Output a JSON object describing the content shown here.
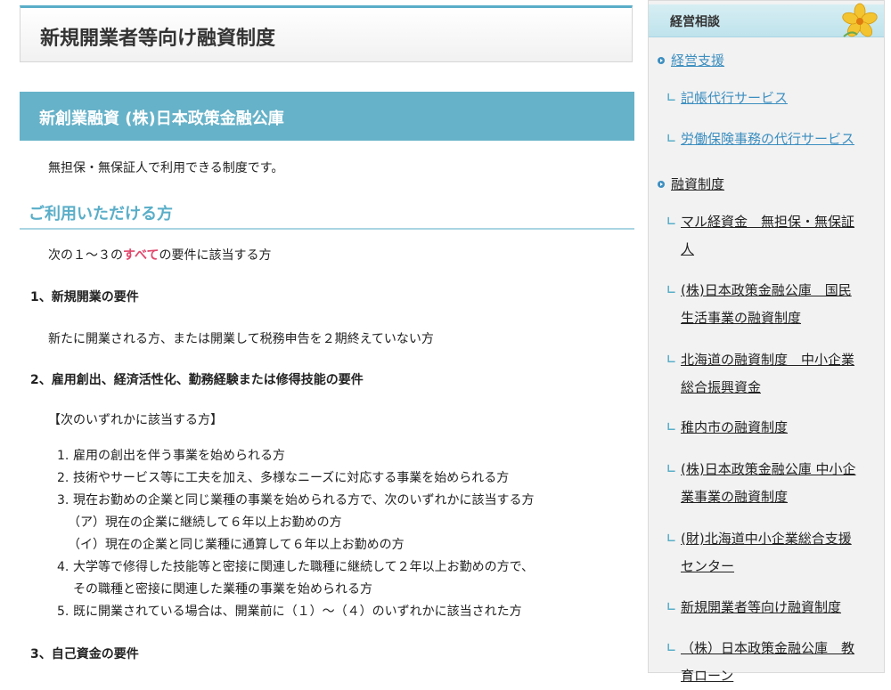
{
  "main": {
    "page_title": "新規開業者等向け融資制度",
    "section_title": "新創業融資 (株)日本政策金融公庫",
    "intro": "無担保・無保証人で利用できる制度です。",
    "eligible_heading": "ご利用いただける方",
    "req_intro_before": "次の１～３の",
    "req_intro_emph": "すべて",
    "req_intro_after": "の要件に該当する方",
    "req1_title": "1、新規開業の要件",
    "req1_text": "新たに開業される方、または開業して税務申告を２期終えていない方",
    "req2_title": "2、雇用創出、経済活性化、勤務経験または修得技能の要件",
    "req2_note": "【次のいずれかに該当する方】",
    "req2_list": [
      {
        "num": "1.",
        "text": "雇用の創出を伴う事業を始められる方"
      },
      {
        "num": "2.",
        "text": "技術やサービス等に工夫を加え、多様なニーズに対応する事業を始められる方"
      },
      {
        "num": "3.",
        "text": "現在お勤めの企業と同じ業種の事業を始められる方で、次のいずれかに該当する方"
      },
      {
        "num": "",
        "text": "（ア）現在の企業に継続して６年以上お勤めの方"
      },
      {
        "num": "",
        "text": "（イ）現在の企業と同じ業種に通算して６年以上お勤めの方"
      },
      {
        "num": "4.",
        "text": "大学等で修得した技能等と密接に関連した職種に継続して２年以上お勤めの方で、"
      },
      {
        "num": "",
        "text": "その職種と密接に関連した業種の事業を始められる方"
      },
      {
        "num": "5.",
        "text": "既に開業されている場合は、開業前に（１）～（４）のいずれかに該当された方"
      }
    ],
    "req3_title": "3、自己資金の要件"
  },
  "sidebar": {
    "header": "経営相談",
    "items": [
      {
        "label": "経営支援",
        "level": "top"
      },
      {
        "label": "記帳代行サービス",
        "level": "sub"
      },
      {
        "label": "労働保険事務の代行サービス",
        "level": "sub"
      },
      {
        "label": "融資制度",
        "level": "top"
      },
      {
        "label": "マル経資金　無担保・無保証人",
        "level": "sub"
      },
      {
        "label": "(株)日本政策金融公庫　国民生活事業の融資制度",
        "level": "sub"
      },
      {
        "label": "北海道の融資制度　中小企業総合振興資金",
        "level": "sub"
      },
      {
        "label": "稚内市の融資制度",
        "level": "sub"
      },
      {
        "label": "(株)日本政策金融公庫 中小企業事業の融資制度",
        "level": "sub"
      },
      {
        "label": "(財)北海道中小企業総合支援センター",
        "level": "sub"
      },
      {
        "label": "新規開業者等向け融資制度",
        "level": "sub"
      },
      {
        "label": "（株）日本政策金融公庫　教育ローン",
        "level": "sub"
      }
    ]
  },
  "colors": {
    "accent": "#66b2c9",
    "heading_blue": "#5aaec8",
    "emphasis_red": "#e0476b",
    "link_blue": "#3d8fc0"
  },
  "icons": [
    "flower-icon",
    "bullet-icon",
    "sub-item-mark-icon"
  ]
}
